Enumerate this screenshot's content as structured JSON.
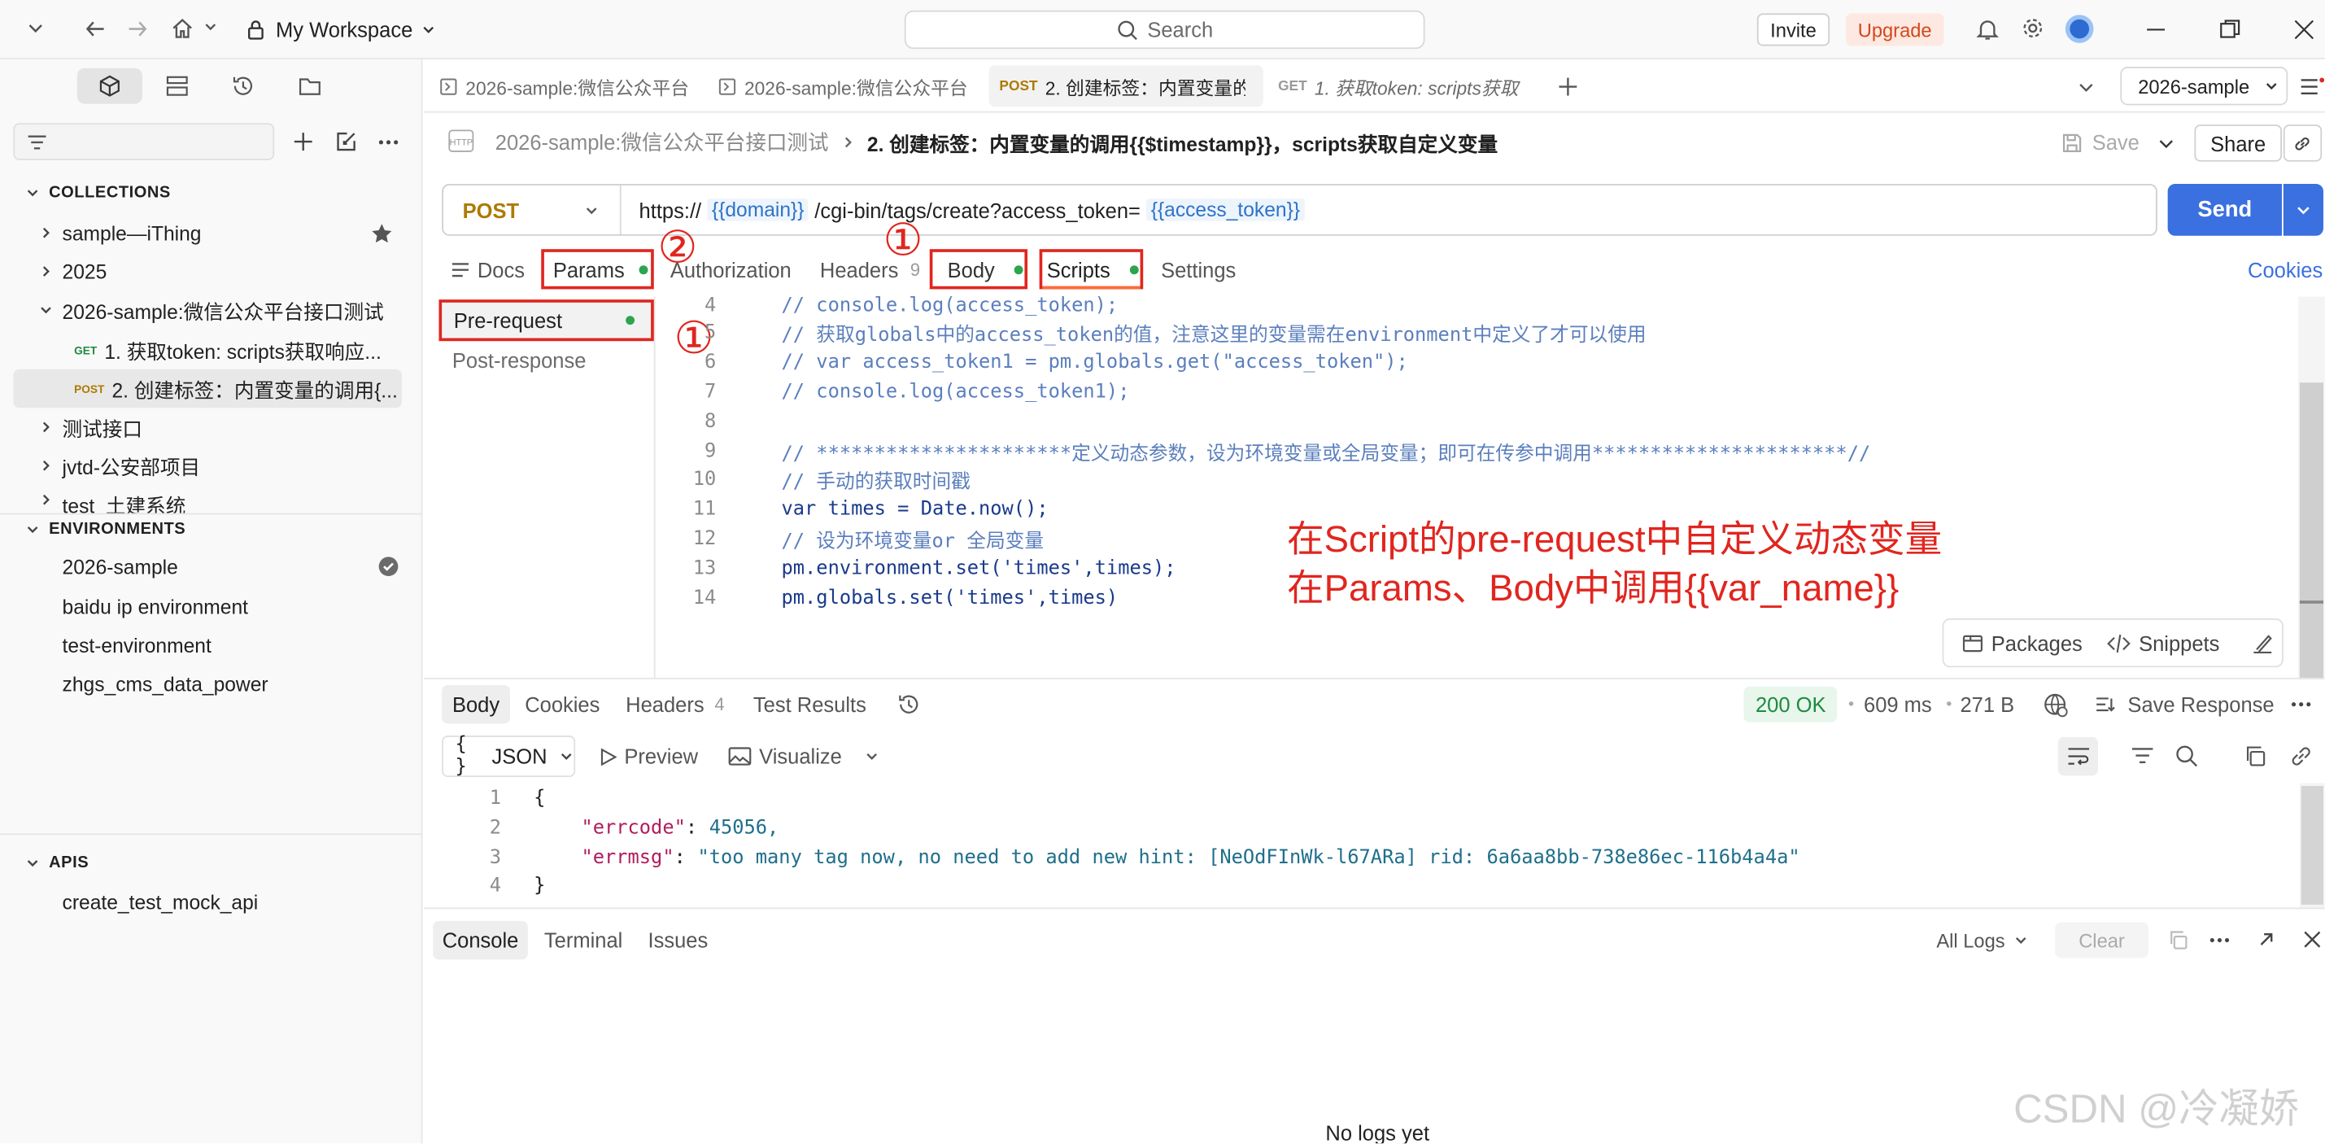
{
  "topbar": {
    "workspace": "My Workspace",
    "search_placeholder": "Search",
    "invite": "Invite",
    "upgrade": "Upgrade"
  },
  "tabs": [
    {
      "label": "2026-sample:微信公众平台"
    },
    {
      "label": "2026-sample:微信公众平台"
    },
    {
      "method": "POST",
      "label": "2. 创建标签：内置变量的"
    },
    {
      "method": "GET",
      "label": "1. 获取token: scripts获取"
    }
  ],
  "env_selector": "2026-sample",
  "breadcrumb": {
    "parent": "2026-sample:微信公众平台接口测试",
    "current": "2. 创建标签：内置变量的调用{{$timestamp}}，scripts获取自定义变量"
  },
  "actions": {
    "save": "Save",
    "share": "Share"
  },
  "request": {
    "method": "POST",
    "url_prefix": "https://",
    "var_domain": "{{domain}}",
    "url_mid": "/cgi-bin/tags/create?access_token=",
    "var_token": "{{access_token}}",
    "send": "Send"
  },
  "req_tabs": {
    "docs": "Docs",
    "params": "Params",
    "authorization": "Authorization",
    "headers": "Headers",
    "headers_count": "9",
    "body": "Body",
    "scripts": "Scripts",
    "settings": "Settings",
    "cookies": "Cookies"
  },
  "script_tabs": {
    "pre": "Pre-request",
    "post": "Post-response"
  },
  "code": [
    {
      "n": "4",
      "t": "// console.log(access_token);"
    },
    {
      "n": "5",
      "t": "// 获取globals中的access_token的值，注意这里的变量需在environment中定义了才可以使用"
    },
    {
      "n": "6",
      "t": "// var access_token1 = pm.globals.get(\"access_token\");"
    },
    {
      "n": "7",
      "t": "// console.log(access_token1);"
    },
    {
      "n": "8",
      "t": ""
    },
    {
      "n": "9",
      "t": "// **********************定义动态参数，设为环境变量或全局变量；即可在传参中调用**********************//"
    },
    {
      "n": "10",
      "t": "// 手动的获取时间戳"
    },
    {
      "n": "11",
      "t": "var times = Date.now();"
    },
    {
      "n": "12",
      "t": "// 设为环境变量or 全局变量"
    },
    {
      "n": "13",
      "t": "pm.environment.set('times',times);"
    },
    {
      "n": "14",
      "t": "pm.globals.set('times',times)"
    }
  ],
  "annotation": {
    "line1": "在Script的pre-request中自定义动态变量",
    "line2": "在Params、Body中调用{{var_name}}",
    "marks": {
      "a": "①",
      "b": "②",
      "c": "①"
    }
  },
  "editor_tools": {
    "packages": "Packages",
    "snippets": "Snippets"
  },
  "response": {
    "tabs": {
      "body": "Body",
      "cookies": "Cookies",
      "headers": "Headers",
      "headers_count": "4",
      "tests": "Test Results"
    },
    "status": "200 OK",
    "time": "609 ms",
    "size": "271 B",
    "save": "Save Response",
    "format": "JSON",
    "preview": "Preview",
    "visualize": "Visualize",
    "lines": [
      {
        "n": "1",
        "t": "{"
      },
      {
        "n": "2",
        "key": "\"errcode\"",
        "val": "45056,"
      },
      {
        "n": "3",
        "key": "\"errmsg\"",
        "val": "\"too many tag now, no need to add new hint: [NeOdFInWk-l67ARa] rid: 6a6aa8bb-738e86ec-116b4a4a\""
      },
      {
        "n": "4",
        "t": "}"
      }
    ]
  },
  "console": {
    "tabs": {
      "console": "Console",
      "terminal": "Terminal",
      "issues": "Issues"
    },
    "all_logs": "All Logs",
    "clear": "Clear",
    "empty": "No logs yet"
  },
  "sidebar": {
    "collections_title": "COLLECTIONS",
    "collections": [
      {
        "label": "sample—iThing"
      },
      {
        "label": "2025"
      },
      {
        "label": "2026-sample:微信公众平台接口测试"
      },
      {
        "method": "GET",
        "label": "1. 获取token: scripts获取响应..."
      },
      {
        "method": "POST",
        "label": "2. 创建标签：内置变量的调用{..."
      },
      {
        "label": "测试接口"
      },
      {
        "label": "jvtd-公安部项目"
      },
      {
        "label": "test_土建系统"
      }
    ],
    "environments_title": "ENVIRONMENTS",
    "environments": [
      {
        "label": "2026-sample"
      },
      {
        "label": "baidu ip environment"
      },
      {
        "label": "test-environment"
      },
      {
        "label": "zhgs_cms_data_power"
      }
    ],
    "apis_title": "APIS",
    "apis": [
      {
        "label": "create_test_mock_api"
      }
    ]
  },
  "watermark": "CSDN @冷凝娇",
  "colors": {
    "accent": "#ff6c37",
    "send": "#3a70e0",
    "var": "#2d74c9",
    "annotate": "#e0261f",
    "ok": "#1f8a3f"
  }
}
